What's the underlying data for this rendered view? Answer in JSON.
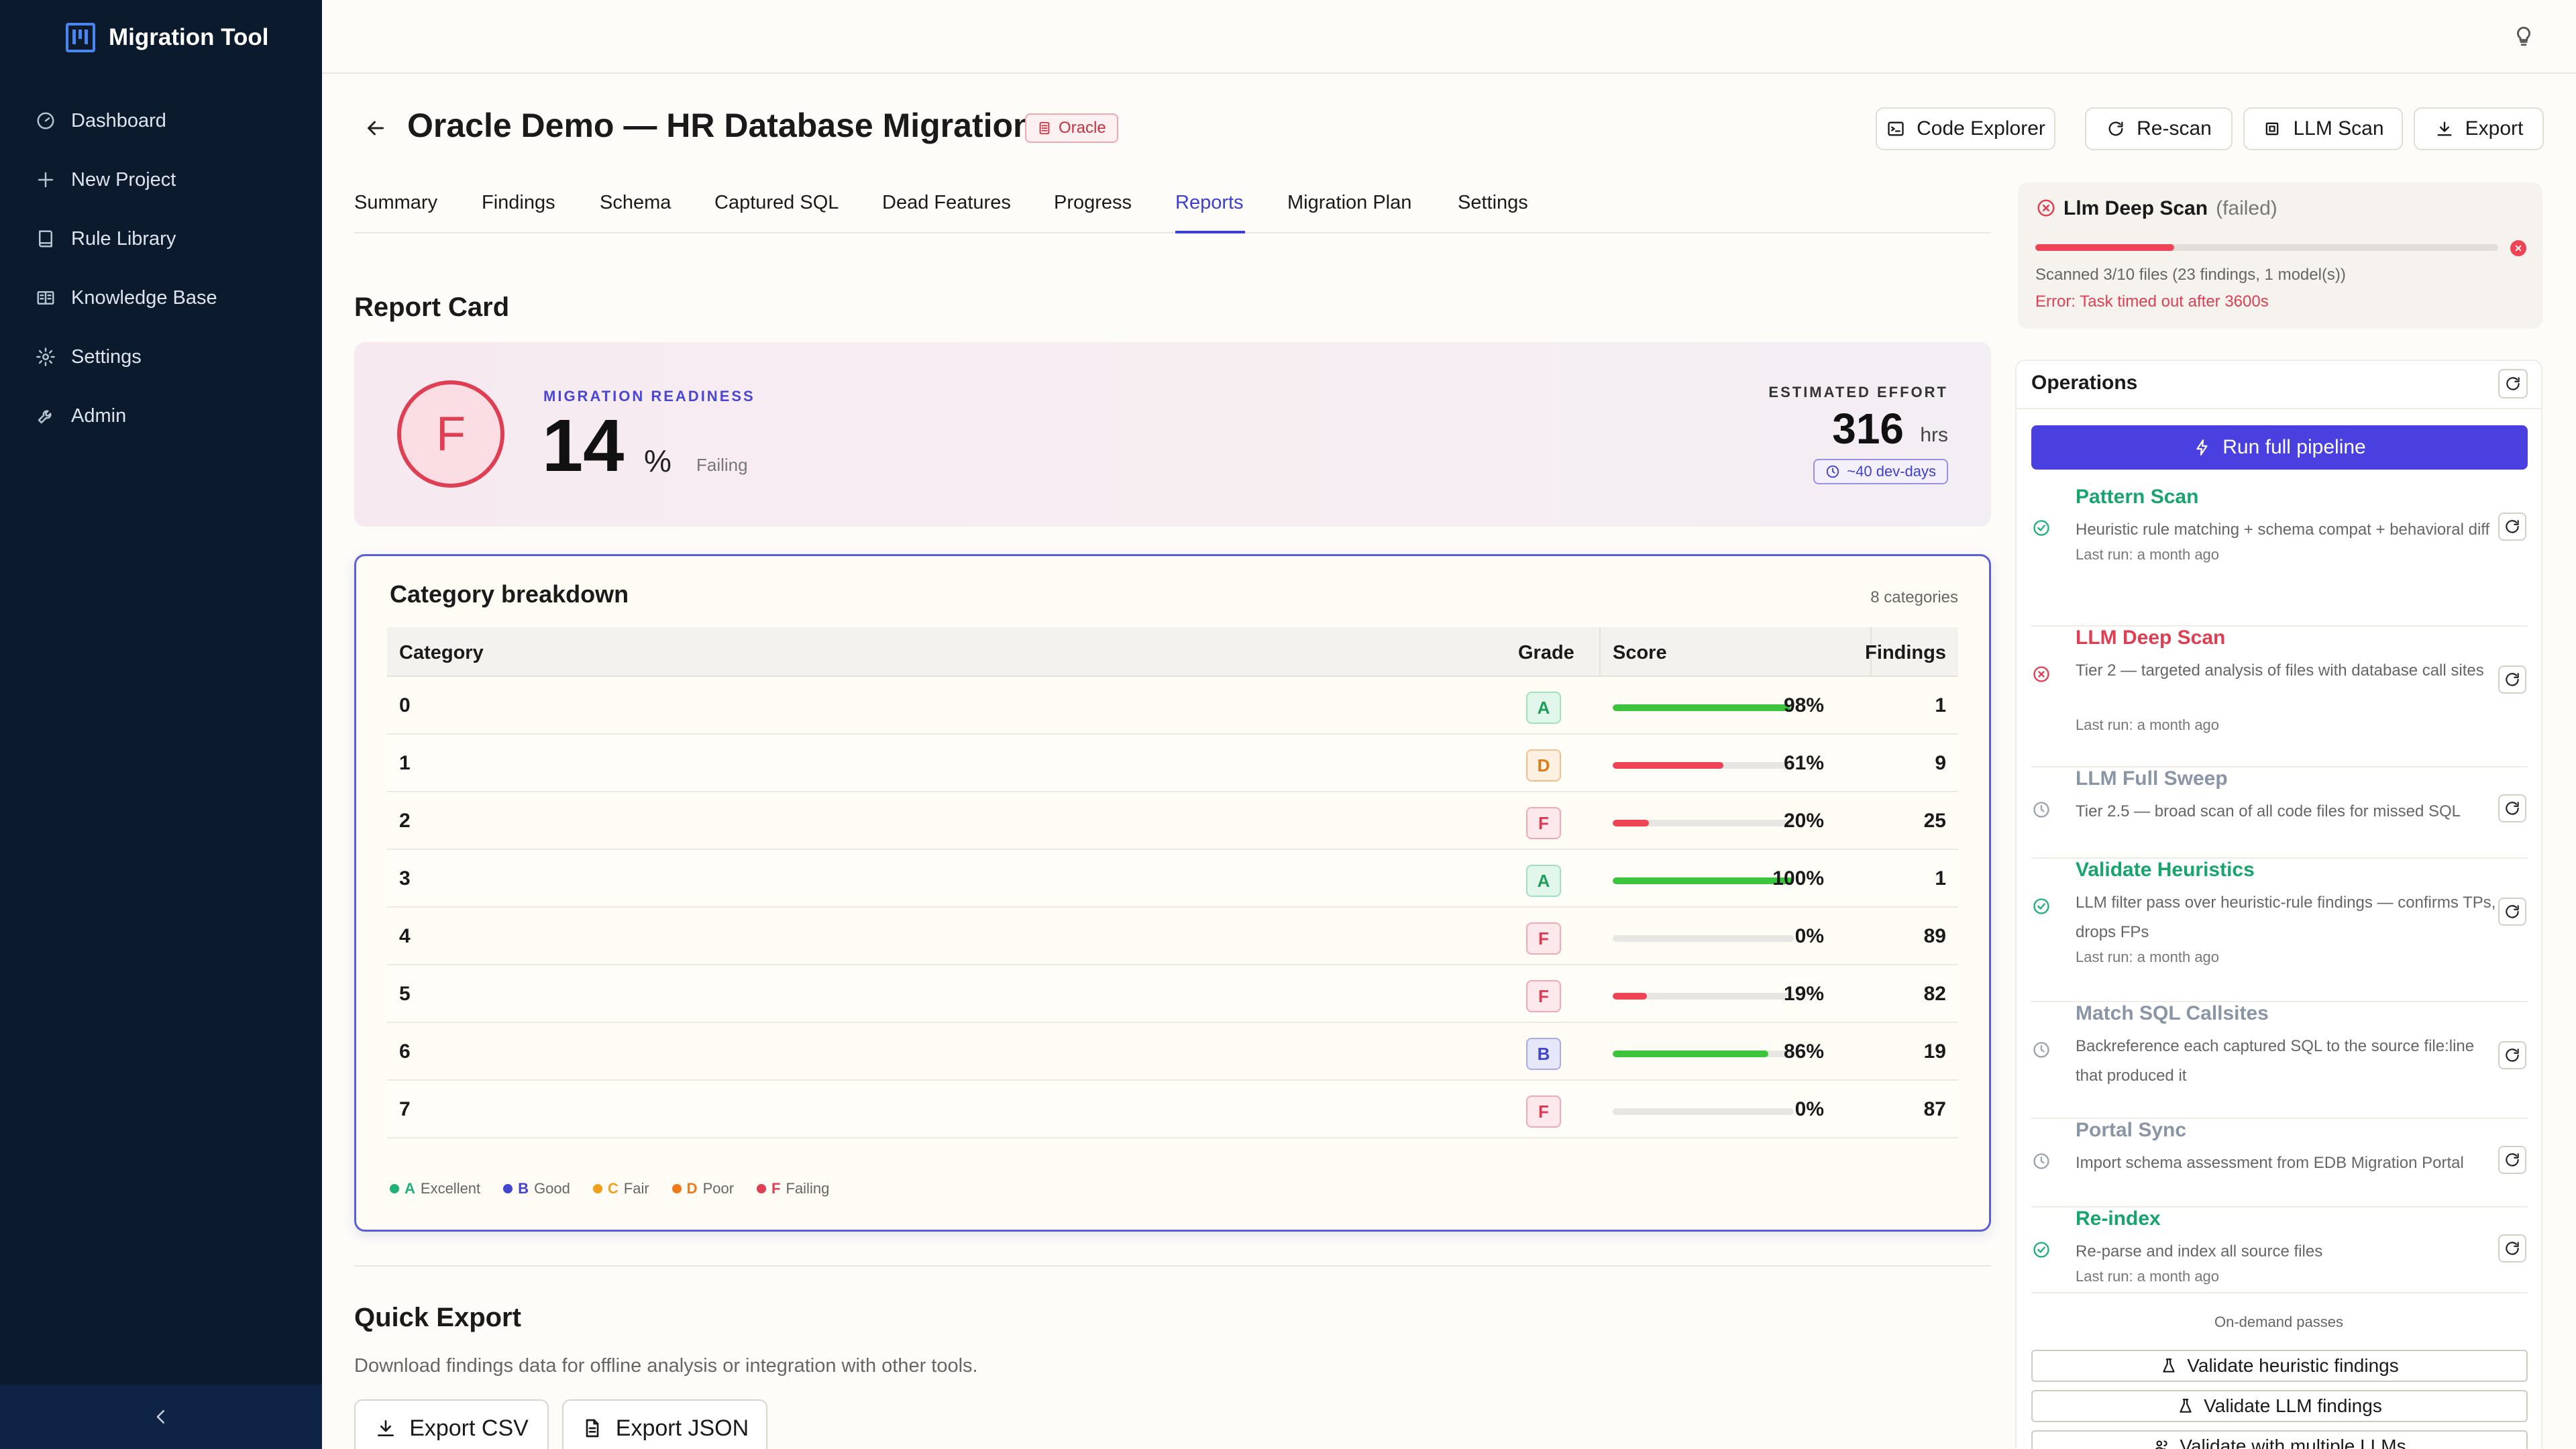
{
  "app": {
    "name": "Migration Tool"
  },
  "sidebar": {
    "items": [
      {
        "label": "Dashboard",
        "icon": "dashboard-icon"
      },
      {
        "label": "New Project",
        "icon": "plus-icon"
      },
      {
        "label": "Rule Library",
        "icon": "book-icon"
      },
      {
        "label": "Knowledge Base",
        "icon": "book-open-icon"
      },
      {
        "label": "Settings",
        "icon": "gear-icon"
      },
      {
        "label": "Admin",
        "icon": "wrench-icon"
      }
    ]
  },
  "header": {
    "title": "Oracle Demo — HR Database Migration",
    "db_badge": "Oracle",
    "buttons": {
      "code_explorer": "Code Explorer",
      "rescan": "Re-scan",
      "llm_scan": "LLM Scan",
      "export": "Export"
    }
  },
  "tabs": [
    "Summary",
    "Findings",
    "Schema",
    "Captured SQL",
    "Dead Features",
    "Progress",
    "Reports",
    "Migration Plan",
    "Settings"
  ],
  "active_tab": "Reports",
  "report_card": {
    "title": "Report Card",
    "grade": "F",
    "readiness_label": "MIGRATION READINESS",
    "readiness_value": "14",
    "readiness_unit": "%",
    "readiness_state": "Failing",
    "effort_label": "ESTIMATED EFFORT",
    "effort_value": "316",
    "effort_unit": "hrs",
    "effort_days": "~40 dev-days"
  },
  "breakdown": {
    "title": "Category breakdown",
    "count": "8 categories",
    "columns": {
      "category": "Category",
      "grade": "Grade",
      "score": "Score",
      "findings": "Findings"
    },
    "rows": [
      {
        "category": "0",
        "grade": "A",
        "score": "98%",
        "score_value": 98,
        "findings": "1"
      },
      {
        "category": "1",
        "grade": "D",
        "score": "61%",
        "score_value": 61,
        "findings": "9"
      },
      {
        "category": "2",
        "grade": "F",
        "score": "20%",
        "score_value": 20,
        "findings": "25"
      },
      {
        "category": "3",
        "grade": "A",
        "score": "100%",
        "score_value": 100,
        "findings": "1"
      },
      {
        "category": "4",
        "grade": "F",
        "score": "0%",
        "score_value": 0,
        "findings": "89"
      },
      {
        "category": "5",
        "grade": "F",
        "score": "19%",
        "score_value": 19,
        "findings": "82"
      },
      {
        "category": "6",
        "grade": "B",
        "score": "86%",
        "score_value": 86,
        "findings": "19"
      },
      {
        "category": "7",
        "grade": "F",
        "score": "0%",
        "score_value": 0,
        "findings": "87"
      }
    ],
    "legend": [
      {
        "grade": "A",
        "label": "Excellent",
        "color": "#1fb07a"
      },
      {
        "grade": "B",
        "label": "Good",
        "color": "#4145d0"
      },
      {
        "grade": "C",
        "label": "Fair",
        "color": "#f0a01c"
      },
      {
        "grade": "D",
        "label": "Poor",
        "color": "#f07a18"
      },
      {
        "grade": "F",
        "label": "Failing",
        "color": "#e03e52"
      }
    ]
  },
  "colors": {
    "good_bar": "#3cc43c",
    "bad_bar": "#ef4455",
    "accent": "#4a40e0"
  },
  "quick_export": {
    "title": "Quick Export",
    "description": "Download findings data for offline analysis or integration with other tools.",
    "csv": "Export CSV",
    "json": "Export JSON"
  },
  "scan_status": {
    "title": "Llm Deep Scan",
    "state": "(failed)",
    "progress": 0.3,
    "info": "Scanned 3/10 files (23 findings, 1 model(s))",
    "error": "Error: Task timed out after 3600s"
  },
  "operations": {
    "title": "Operations",
    "run_label": "Run full pipeline",
    "items": [
      {
        "name": "Pattern Scan",
        "desc": "Heuristic rule matching + schema compat + behavioral diff",
        "last_run": "Last run: a month ago",
        "status": "ok"
      },
      {
        "name": "LLM Deep Scan",
        "desc": "Tier 2 — targeted analysis of files with database call sites",
        "last_run": "Last run: a month ago",
        "status": "fail"
      },
      {
        "name": "LLM Full Sweep",
        "desc": "Tier 2.5 — broad scan of all code files for missed SQL",
        "last_run": "",
        "status": "idle"
      },
      {
        "name": "Validate Heuristics",
        "desc": "LLM filter pass over heuristic-rule findings — confirms TPs, drops FPs",
        "last_run": "Last run: a month ago",
        "status": "ok"
      },
      {
        "name": "Match SQL Callsites",
        "desc": "Backreference each captured SQL to the source file:line that produced it",
        "last_run": "",
        "status": "idle"
      },
      {
        "name": "Portal Sync",
        "desc": "Import schema assessment from EDB Migration Portal",
        "last_run": "",
        "status": "idle"
      },
      {
        "name": "Re-index",
        "desc": "Re-parse and index all source files",
        "last_run": "Last run: a month ago",
        "status": "ok"
      }
    ],
    "on_demand_label": "On-demand passes",
    "on_demand": [
      "Validate heuristic findings",
      "Validate LLM findings",
      "Validate with multiple LLMs"
    ]
  }
}
